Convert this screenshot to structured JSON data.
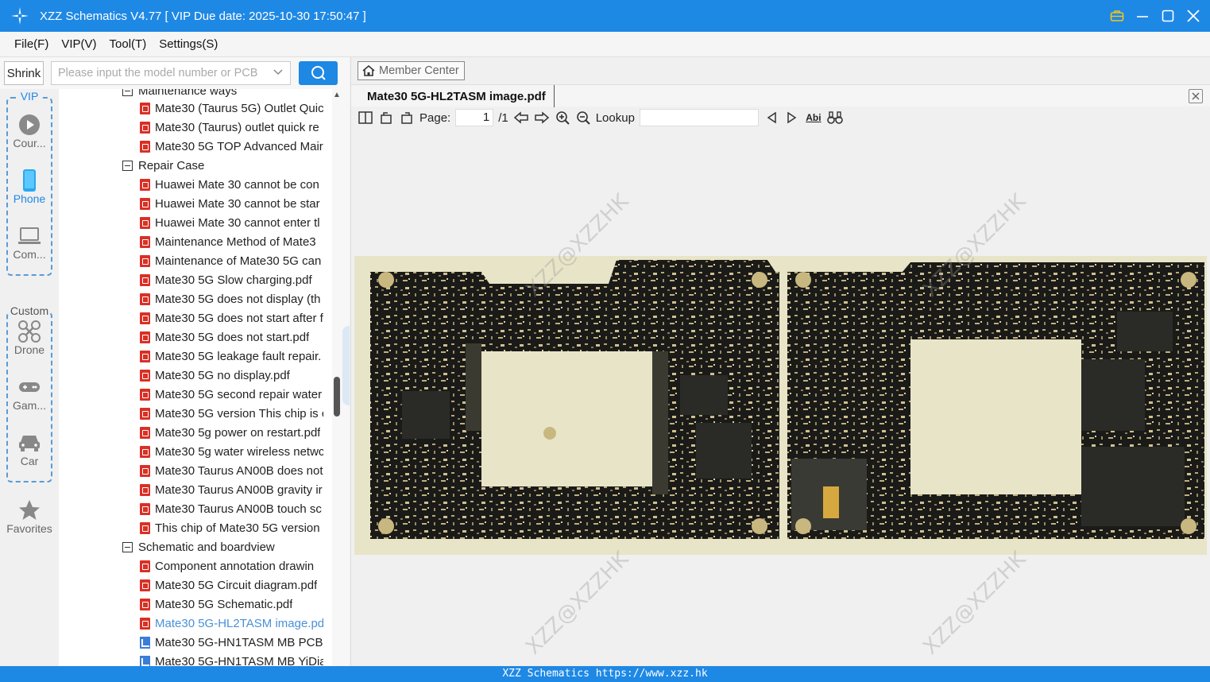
{
  "window": {
    "title": "XZZ Schematics V4.77 [ VIP Due date: 2025-10-30 17:50:47 ]"
  },
  "menu": [
    "File(F)",
    "VIP(V)",
    "Tool(T)",
    "Settings(S)"
  ],
  "search": {
    "shrink_label": "Shrink",
    "placeholder": "Please input the model number or PCB"
  },
  "categories": {
    "vip_label": "VIP",
    "custom_label": "Custom",
    "vip_items": [
      {
        "label": "Cour...",
        "icon": "play-icon"
      },
      {
        "label": "Phone",
        "icon": "phone-icon"
      },
      {
        "label": "Com...",
        "icon": "laptop-icon"
      }
    ],
    "custom_items": [
      {
        "label": "Drone",
        "icon": "drone-icon"
      },
      {
        "label": "Gam...",
        "icon": "gamepad-icon"
      },
      {
        "label": "Car",
        "icon": "car-icon"
      }
    ],
    "favorites_label": "Favorites"
  },
  "tree": {
    "folder_partial": "Maintenance ways",
    "items_top": [
      "Mate30 (Taurus 5G) Outlet Quic",
      "Mate30 (Taurus) outlet quick re",
      "Mate30 5G TOP Advanced Mair"
    ],
    "folder_repair": "Repair Case",
    "repair_items": [
      "Huawei Mate 30 cannot be con",
      "Huawei Mate 30 cannot be star",
      "Huawei Mate 30 cannot enter tl",
      "Maintenance Method of Mate3",
      "Maintenance of Mate30 5G can",
      "Mate30 5G Slow charging.pdf",
      "Mate30 5G does not display (th",
      "Mate30 5G does not start after f",
      "Mate30 5G does not start.pdf",
      "Mate30 5G leakage fault repair.",
      "Mate30 5G no display.pdf",
      "Mate30 5G second repair water",
      "Mate30 5G version This chip is c",
      "Mate30 5g power on restart.pdf",
      "Mate30 5g water wireless netwc",
      "Mate30 Taurus AN00B does not",
      "Mate30 Taurus AN00B gravity ir",
      "Mate30 Taurus AN00B touch sc",
      "This chip of Mate30 5G version"
    ],
    "folder_schematic": "Schematic and boardview",
    "schematic_items": [
      {
        "label": "Component annotation drawin",
        "type": "pdf"
      },
      {
        "label": "Mate30 5G Circuit diagram.pdf",
        "type": "pdf"
      },
      {
        "label": "Mate30 5G Schematic.pdf",
        "type": "pdf"
      },
      {
        "label": "Mate30 5G-HL2TASM image.pd",
        "type": "pdf",
        "selected": true
      },
      {
        "label": "Mate30 5G-HN1TASM MB PCB",
        "type": "pcb"
      },
      {
        "label": "Mate30 5G-HN1TASM MB YiDia",
        "type": "pcb"
      }
    ]
  },
  "viewer": {
    "member_center": "Member Center",
    "doc_tab": "Mate30 5G-HL2TASM image.pdf",
    "page_label": "Page:",
    "page_value": "1",
    "page_total": "/1",
    "lookup_label": "Lookup",
    "abi_label": "Abi",
    "watermark": "XZZ@XZZHK"
  },
  "status": "XZZ Schematics https://www.xzz.hk",
  "colors": {
    "accent": "#1e88e5",
    "selected_text": "#4a90d9",
    "pcb_board": "#1a1a18",
    "pcb_background": "#e8e4c8"
  }
}
